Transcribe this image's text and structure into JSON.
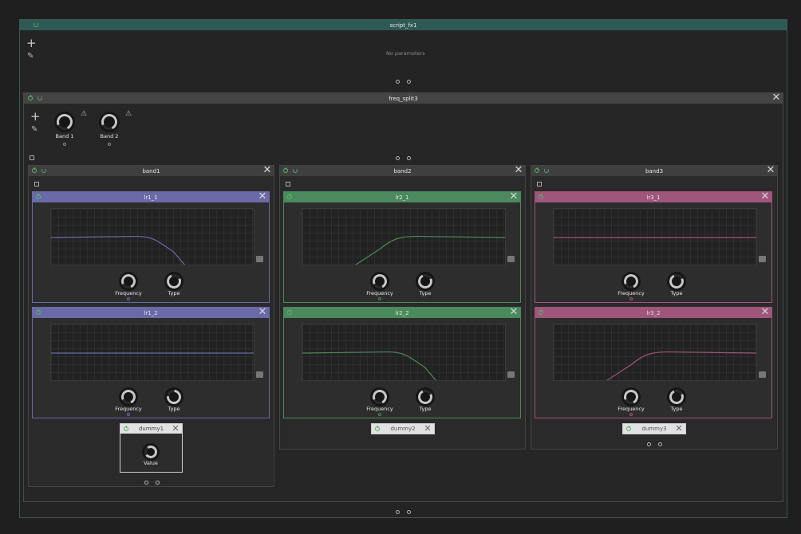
{
  "script": {
    "title": "script_fx1",
    "empty_text": "No parameters"
  },
  "split": {
    "title": "freq_split3",
    "knobs": [
      {
        "label": "Band 1"
      },
      {
        "label": "Band 2"
      }
    ]
  },
  "bands": [
    {
      "title": "band1",
      "accent": "#6a6aa8",
      "filters": [
        {
          "title": "lr1_1",
          "curve": "lowpass"
        },
        {
          "title": "lr1_2",
          "curve": "flat"
        }
      ],
      "dummy": {
        "title": "dummy1",
        "value_label": "Value"
      }
    },
    {
      "title": "band2",
      "accent": "#4a8a5c",
      "filters": [
        {
          "title": "lr2_1",
          "curve": "highpass"
        },
        {
          "title": "lr2_2",
          "curve": "lowpass"
        }
      ],
      "dummy": {
        "title": "dummy2"
      }
    },
    {
      "title": "band3",
      "accent": "#a0557a",
      "filters": [
        {
          "title": "lr3_1",
          "curve": "flat"
        },
        {
          "title": "lr3_2",
          "curve": "highpass"
        }
      ],
      "dummy": {
        "title": "dummy3"
      }
    }
  ],
  "labels": {
    "frequency": "Frequency",
    "type": "Type"
  },
  "icons": {
    "power": "power-icon",
    "refresh": "refresh-icon",
    "close": "close-icon",
    "add": "plus-icon",
    "edit": "pencil-icon",
    "warning": "warning-icon",
    "popout": "external-link-icon",
    "screenshot": "camera-icon"
  },
  "colors": {
    "background": "#1f1f1f",
    "script_header": "#2e5a55",
    "split_header": "#444444",
    "band_header": "#3f3f3f",
    "band1": "#6a6aa8",
    "band2": "#4a8a5c",
    "band3": "#a0557a"
  }
}
